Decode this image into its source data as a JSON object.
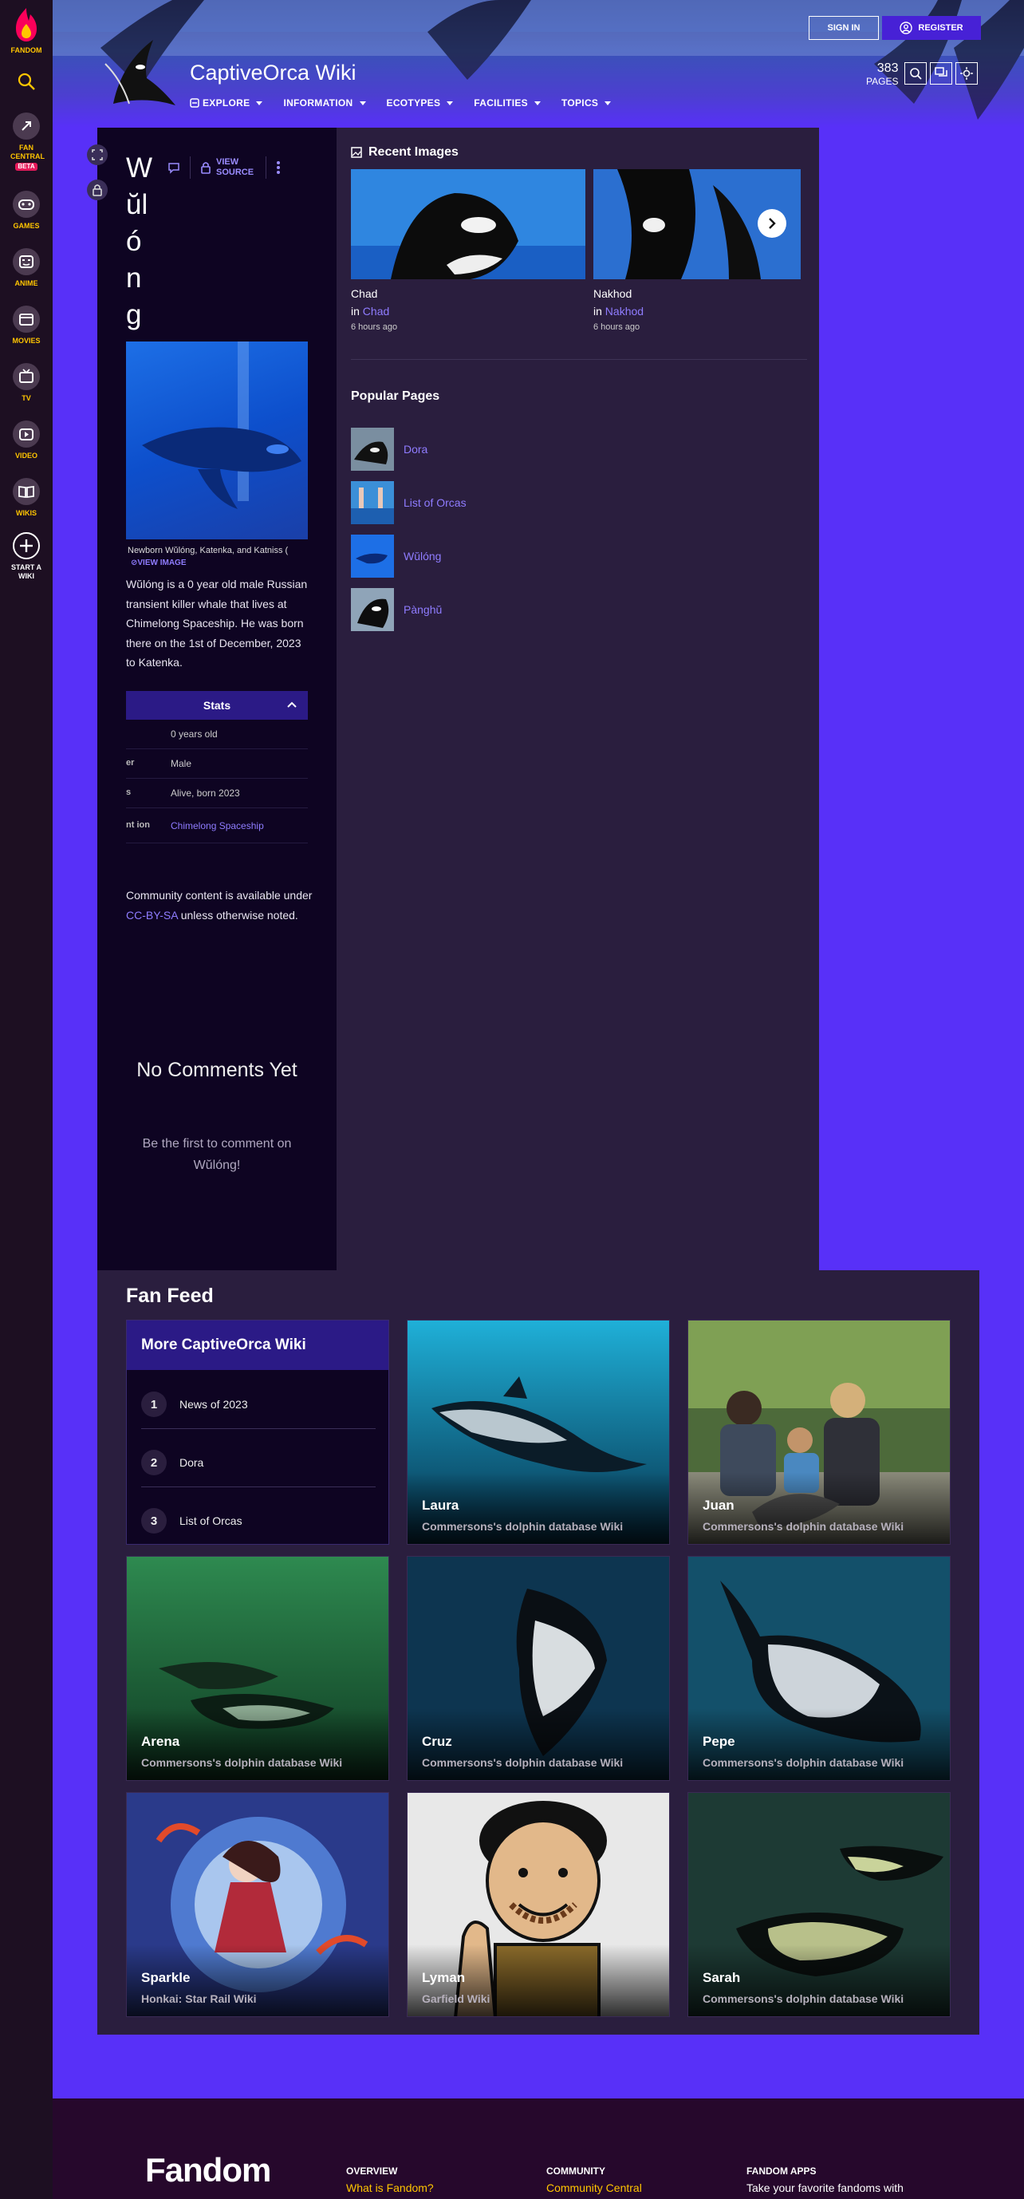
{
  "rail": {
    "items": [
      {
        "label": "FANDOM"
      },
      {
        "label": "FAN CENTRAL",
        "badge": "BETA"
      },
      {
        "label": "GAMES"
      },
      {
        "label": "ANIME"
      },
      {
        "label": "MOVIES"
      },
      {
        "label": "TV"
      },
      {
        "label": "VIDEO"
      },
      {
        "label": "WIKIS"
      },
      {
        "label": "START A WIKI"
      }
    ]
  },
  "header": {
    "wiki_name": "CaptiveOrca Wiki",
    "nav": [
      "EXPLORE",
      "INFORMATION",
      "ECOTYPES",
      "FACILITIES",
      "TOPICS"
    ],
    "sign_in": "SIGN IN",
    "register": "REGISTER",
    "page_count": "383",
    "page_count_label": "PAGES"
  },
  "article": {
    "title_letters": [
      "W",
      "ŭl",
      "ó",
      "n",
      "g"
    ],
    "view_source": "VIEW SOURCE",
    "image_caption": "Newborn Wŭlóng, Katenka, and Katniss (",
    "view_image": "VIEW IMAGE",
    "bio": "Wŭlóng is a 0 year old male Russian transient killer whale that lives at Chimelong Spaceship. He was born there on the 1st of December, 2023 to Katenka.",
    "stats_title": "Stats",
    "stats": [
      {
        "key": "",
        "value": "0 years old"
      },
      {
        "key": "er",
        "value": "Male"
      },
      {
        "key": "s",
        "value": "Alive, born 2023"
      },
      {
        "key": "nt ion",
        "value": "Chimelong Spaceship"
      }
    ],
    "license_pre": "Community content is available under ",
    "license_link": "CC-BY-SA",
    "license_post": " unless otherwise noted.",
    "no_comments": "No Comments Yet",
    "be_first": "Be the first to comment on Wŭlóng!"
  },
  "recent_images": {
    "title": "Recent Images",
    "items": [
      {
        "name": "Chad",
        "in_prefix": "in",
        "link": "Chad",
        "time": "6 hours ago"
      },
      {
        "name": "Nakhod",
        "in_prefix": "in",
        "link": "Nakhod",
        "time": "6 hours ago"
      }
    ]
  },
  "popular_pages": {
    "title": "Popular Pages",
    "items": [
      "Dora",
      "List of Orcas",
      "Wŭlóng",
      "Pànghŭ"
    ]
  },
  "fan_feed": {
    "title": "Fan Feed",
    "more_title": "More CaptiveOrca Wiki",
    "more_items": [
      {
        "num": "1",
        "label": "News of 2023"
      },
      {
        "num": "2",
        "label": "Dora"
      },
      {
        "num": "3",
        "label": "List of Orcas"
      }
    ],
    "cards": [
      {
        "title": "Laura",
        "source": "Commersons's dolphin database Wiki"
      },
      {
        "title": "Juan",
        "source": "Commersons's dolphin database Wiki"
      },
      {
        "title": "Arena",
        "source": "Commersons's dolphin database Wiki"
      },
      {
        "title": "Cruz",
        "source": "Commersons's dolphin database Wiki"
      },
      {
        "title": "Pepe",
        "source": "Commersons's dolphin database Wiki"
      },
      {
        "title": "Sparkle",
        "source": "Honkai: Star Rail Wiki"
      },
      {
        "title": "Lyman",
        "source": "Garfield Wiki"
      },
      {
        "title": "Sarah",
        "source": "Commersons's dolphin database Wiki"
      }
    ]
  },
  "footer": {
    "logo": "Fandom",
    "col1_title": "OVERVIEW",
    "col1_link": "What is Fandom?",
    "col2_title": "COMMUNITY",
    "col2_link": "Community Central",
    "col3_title": "FANDOM APPS",
    "col3_text": "Take your favorite fandoms with"
  },
  "colors": {
    "accent": "#5830f8",
    "link": "#8f7cff",
    "brand_yellow": "#ffc500",
    "brand_pink": "#fa005a"
  }
}
